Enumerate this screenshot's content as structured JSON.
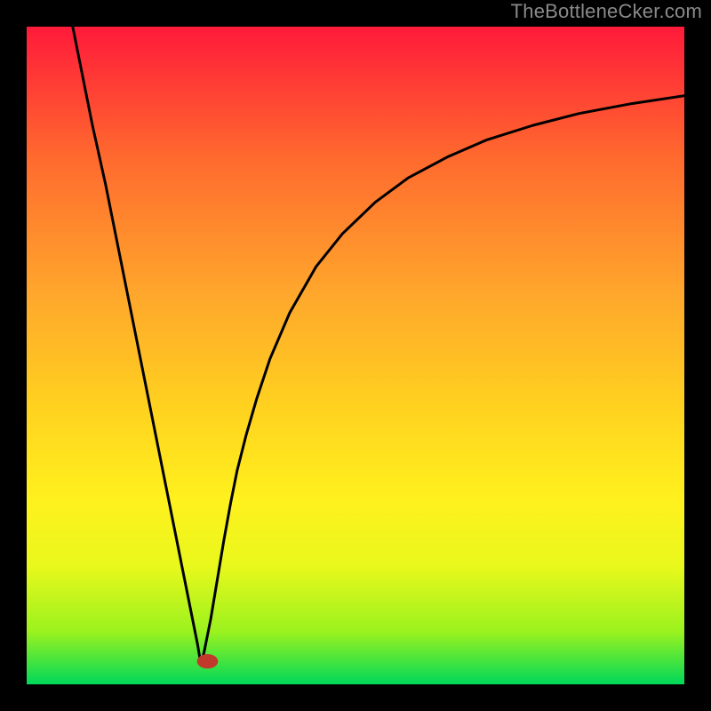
{
  "watermark": "TheBottleneCker.com",
  "chart_data": {
    "type": "line",
    "title": "",
    "xlabel": "",
    "ylabel": "",
    "xlim": [
      0,
      100
    ],
    "ylim": [
      0,
      100
    ],
    "background_gradient": {
      "stops": [
        "#ff1a3a",
        "#ff6a2e",
        "#ffa52c",
        "#ffd21f",
        "#fff11e",
        "#e9f81c",
        "#9bf21e",
        "#00d85a"
      ],
      "positions": [
        0,
        20,
        40,
        58,
        72,
        82,
        92,
        100
      ]
    },
    "curve_min": {
      "x": 26.5,
      "y": 3
    },
    "marker": {
      "x": 27.5,
      "y": 3.5,
      "rx": 1.6,
      "ry": 1.1,
      "color": "#c0392b"
    },
    "series": [
      {
        "name": "bottleneck-curve-left",
        "x": [
          7,
          8,
          9,
          10,
          12,
          14,
          16,
          18,
          20,
          22,
          24,
          25,
          26,
          26.5
        ],
        "y": [
          100,
          95,
          90,
          85,
          76,
          66,
          56,
          46,
          36,
          26,
          16,
          11,
          6,
          3
        ]
      },
      {
        "name": "bottleneck-curve-right",
        "x": [
          26.5,
          27,
          28,
          29,
          30,
          31,
          32,
          33.4,
          35,
          37,
          40,
          44,
          48,
          53,
          58,
          64,
          70,
          77,
          84,
          92,
          100
        ],
        "y": [
          3,
          5,
          10,
          16,
          22,
          27.5,
          32.5,
          38,
          43.5,
          49.5,
          56.5,
          63.5,
          68.5,
          73.3,
          77,
          80.2,
          82.8,
          85,
          86.8,
          88.3,
          89.5
        ]
      }
    ]
  }
}
